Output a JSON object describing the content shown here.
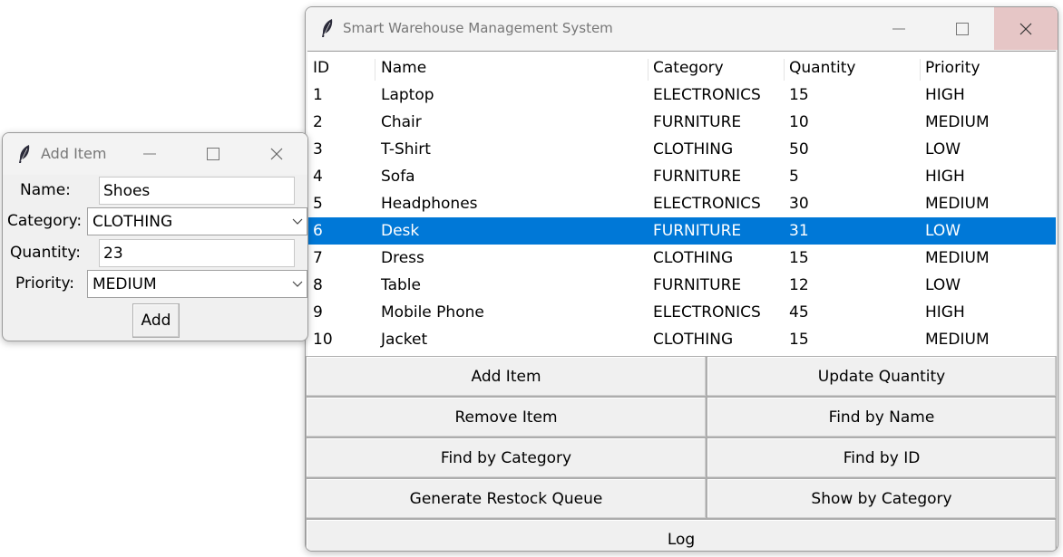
{
  "main_window": {
    "title": "Smart Warehouse Management System",
    "columns": [
      "ID",
      "Name",
      "Category",
      "Quantity",
      "Priority"
    ],
    "rows": [
      [
        "1",
        "Laptop",
        "ELECTRONICS",
        "15",
        "HIGH"
      ],
      [
        "2",
        "Chair",
        "FURNITURE",
        "10",
        "MEDIUM"
      ],
      [
        "3",
        "T-Shirt",
        "CLOTHING",
        "50",
        "LOW"
      ],
      [
        "4",
        "Sofa",
        "FURNITURE",
        "5",
        "HIGH"
      ],
      [
        "5",
        "Headphones",
        "ELECTRONICS",
        "30",
        "MEDIUM"
      ],
      [
        "6",
        "Desk",
        "FURNITURE",
        "31",
        "LOW"
      ],
      [
        "7",
        "Dress",
        "CLOTHING",
        "15",
        "MEDIUM"
      ],
      [
        "8",
        "Table",
        "FURNITURE",
        "12",
        "LOW"
      ],
      [
        "9",
        "Mobile Phone",
        "ELECTRONICS",
        "45",
        "HIGH"
      ],
      [
        "10",
        "Jacket",
        "CLOTHING",
        "15",
        "MEDIUM"
      ]
    ],
    "selected_row_index": 5,
    "buttons": {
      "add_item": "Add Item",
      "update_quantity": "Update Quantity",
      "remove_item": "Remove Item",
      "find_by_name": "Find by Name",
      "find_by_category": "Find by Category",
      "find_by_id": "Find by ID",
      "generate_restock_queue": "Generate Restock Queue",
      "show_by_category": "Show by Category",
      "log": "Log"
    },
    "selection_color": "#0078d7"
  },
  "add_window": {
    "title": "Add Item",
    "name_label": "Name:",
    "name_value": "Shoes",
    "category_label": "Category:",
    "category_value": "CLOTHING",
    "quantity_label": "Quantity:",
    "quantity_value": "23",
    "priority_label": "Priority:",
    "priority_value": "MEDIUM",
    "add_button": "Add"
  },
  "icons": {
    "app_icon": "feather-icon",
    "minimize": "minimize-icon",
    "maximize": "maximize-icon",
    "close": "close-icon",
    "dropdown": "chevron-down-icon"
  }
}
